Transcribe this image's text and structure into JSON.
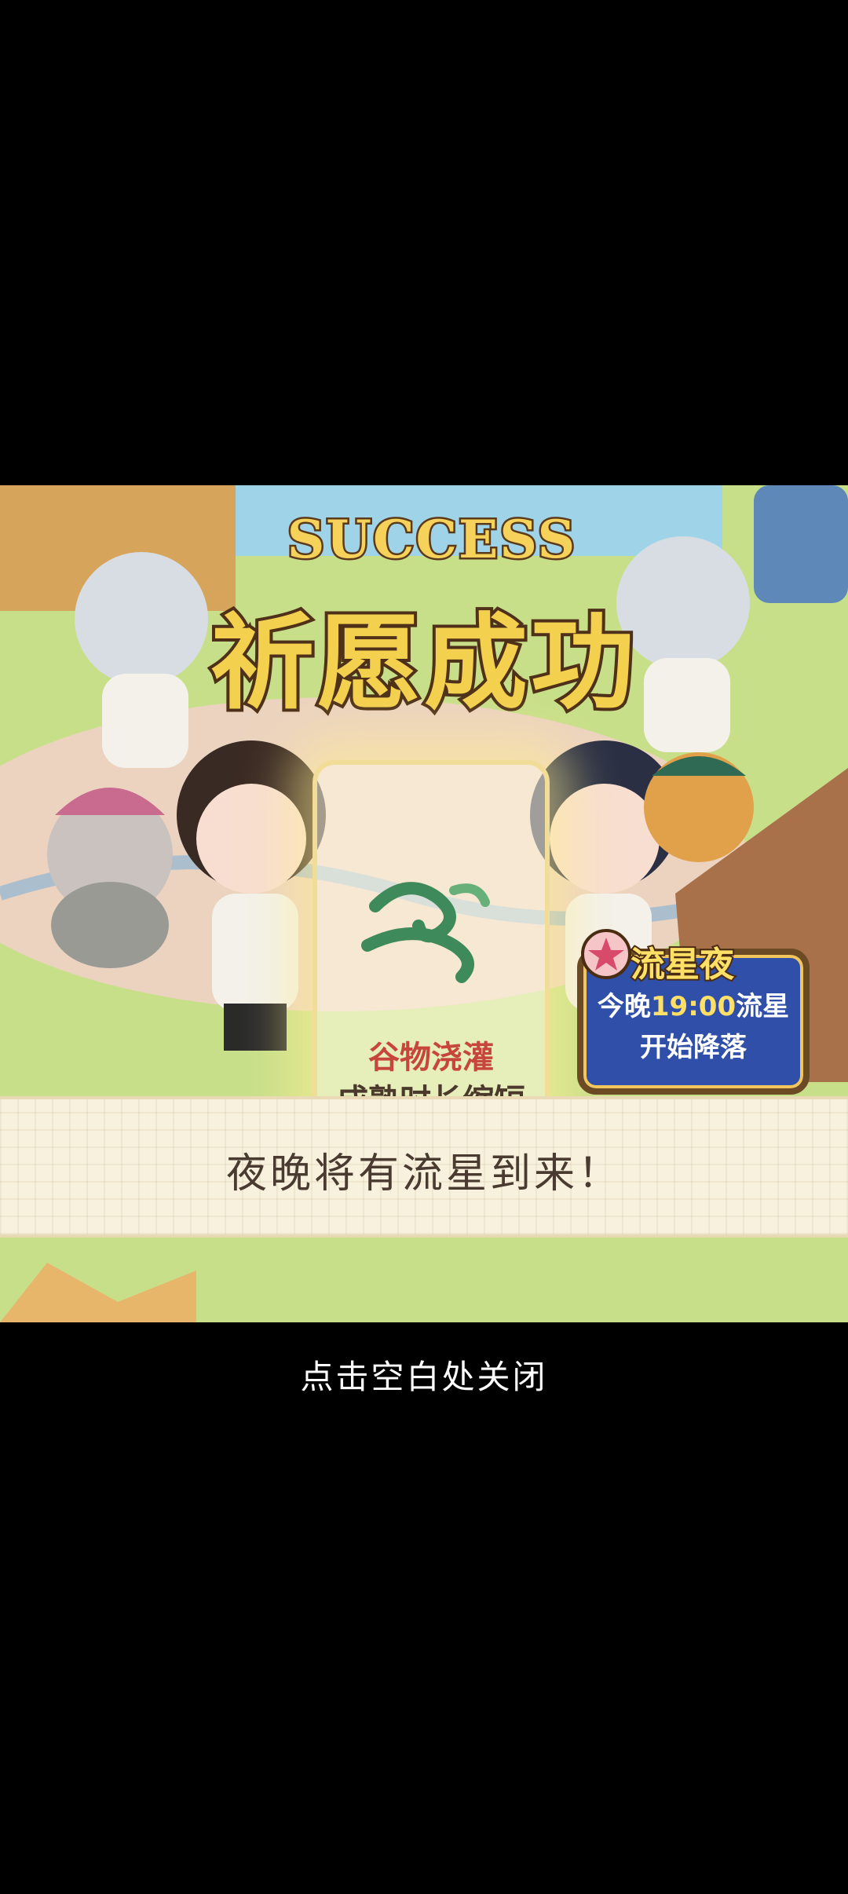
{
  "popup": {
    "title_en": "SUCCESS",
    "title_cn": "祈愿成功",
    "reward": {
      "name": "谷物浇灌",
      "description": "成熟时长缩短",
      "icon": "wind-swirl-icon"
    },
    "event_badge": {
      "title": "流星夜",
      "line1_prefix": "今晚",
      "line1_time": "19:00",
      "line1_suffix": "流星",
      "line2": "开始降落",
      "icon": "shooting-star-icon"
    },
    "banner_message": "夜晚将有流星到来！"
  },
  "close_hint": "点击空白处关闭",
  "colors": {
    "background": "#000000",
    "title_gold": "#f3d04e",
    "reward_red": "#c7463c",
    "event_blue": "#2f4fa8"
  }
}
